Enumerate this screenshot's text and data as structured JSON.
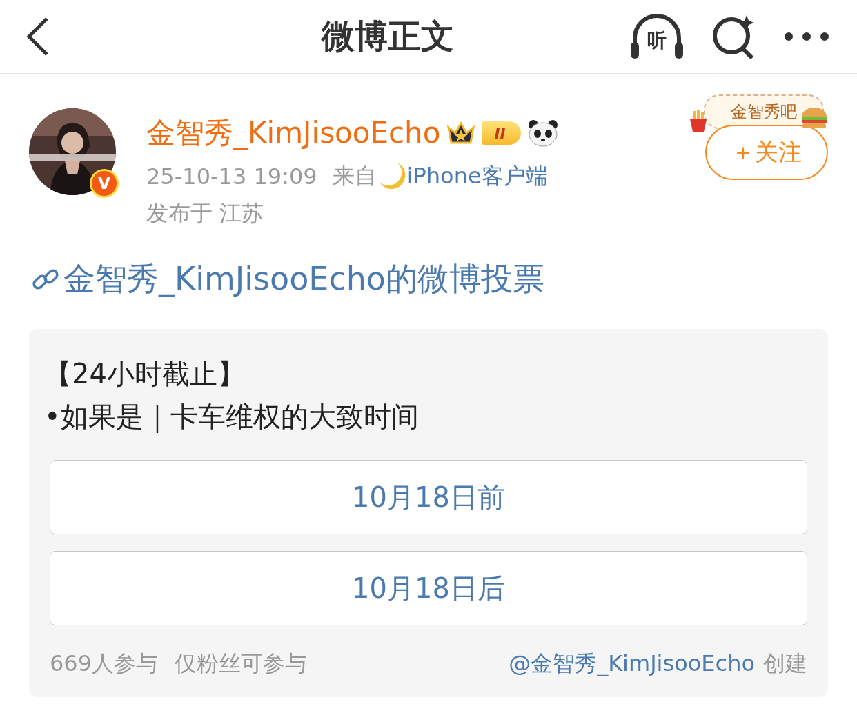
{
  "nav": {
    "title": "微博正文",
    "listen_label": "听"
  },
  "author": {
    "name": "金智秀_KimJisooEcho",
    "verified_badge": "V",
    "level_badge": "II",
    "time": "25-10-13 19:09",
    "source_prefix": "来自",
    "source": "iPhone客户端",
    "location": "发布于 江苏",
    "fan_tag": "金智秀吧",
    "follow_button": "＋关注"
  },
  "post": {
    "link_title": "金智秀_KimJisooEcho的微博投票"
  },
  "poll": {
    "question_lines": [
      "【24小时截止】",
      "•如果是｜卡车维权的大致时间"
    ],
    "options": [
      {
        "label": "10月18日前"
      },
      {
        "label": "10月18日后"
      }
    ],
    "participants": "669人参与",
    "restriction": "仅粉丝可参与",
    "creator": "@金智秀_KimJisooEcho",
    "creator_suffix": "创建"
  }
}
